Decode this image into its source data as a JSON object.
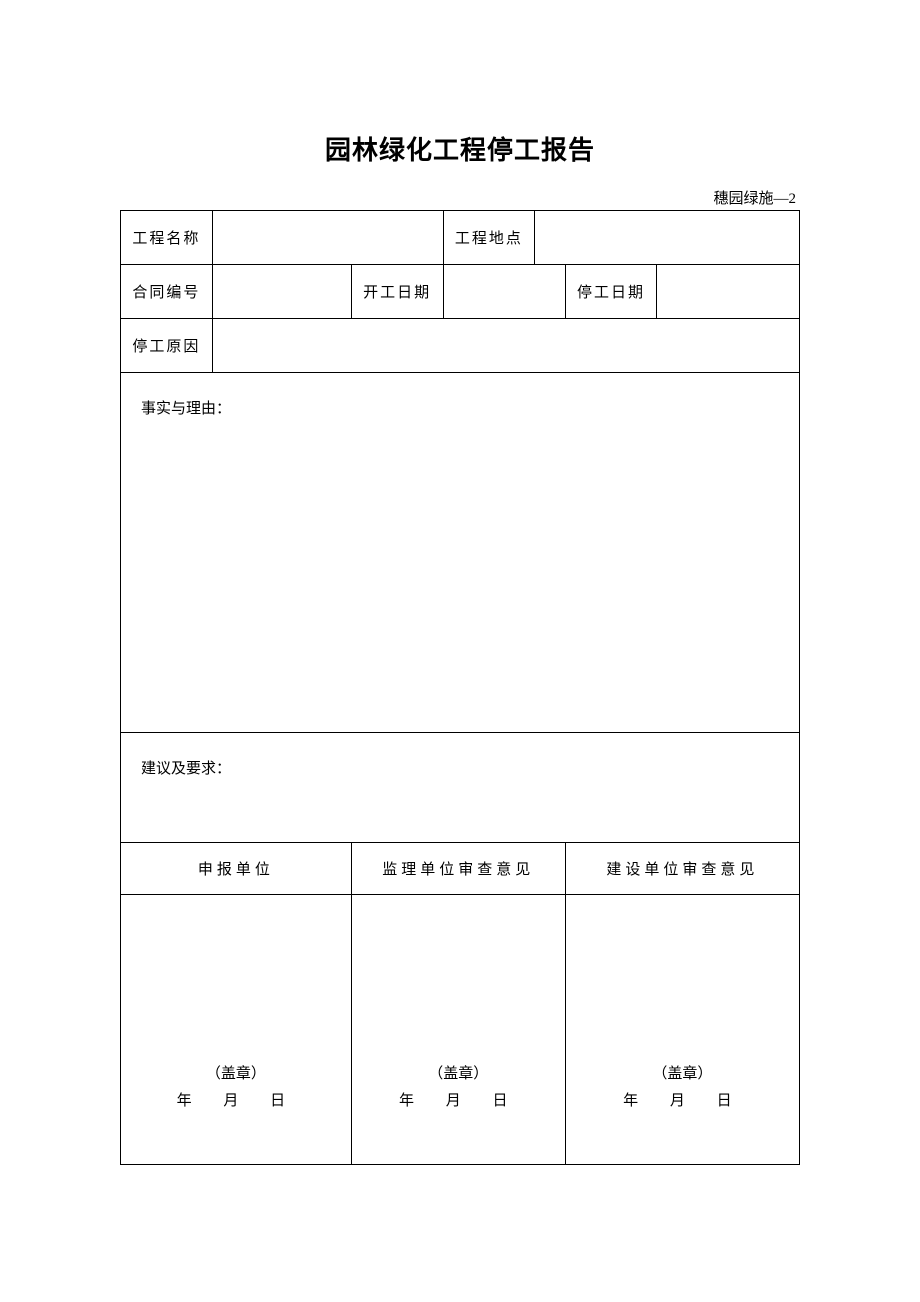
{
  "title": "园林绿化工程停工报告",
  "form_code": "穗园绿施—2",
  "labels": {
    "project_name": "工程名称",
    "project_location": "工程地点",
    "contract_no": "合同编号",
    "start_date": "开工日期",
    "stop_date": "停工日期",
    "stop_reason": "停工原因",
    "facts_reason": "事实与理由：",
    "suggestions": "建议及要求："
  },
  "values": {
    "project_name": "",
    "project_location": "",
    "contract_no": "",
    "start_date": "",
    "stop_date": "",
    "stop_reason": ""
  },
  "sections": {
    "applicant": "申报单位",
    "supervisor": "监理单位审查意见",
    "owner": "建设单位审查意见"
  },
  "signature": {
    "stamp": "（盖章）",
    "year": "年",
    "month": "月",
    "day": "日"
  }
}
